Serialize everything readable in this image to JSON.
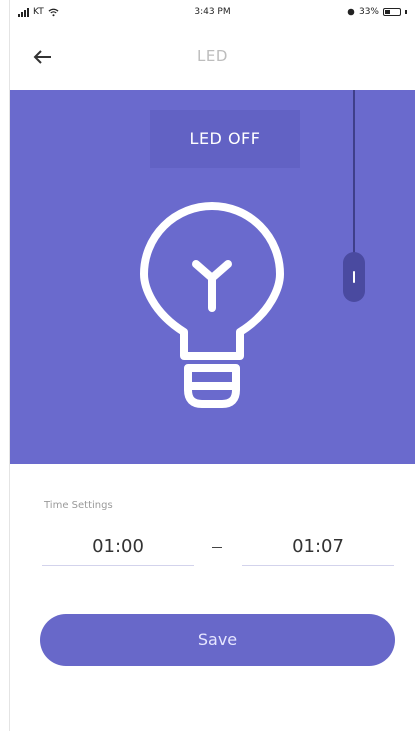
{
  "status_bar": {
    "carrier": "KT",
    "time": "3:43 PM",
    "battery_percent": "33%",
    "battery_level": 0.33,
    "signal_icon": "signal-bars-icon",
    "wifi_icon": "wifi-icon",
    "alarm_icon": "alarm-icon",
    "battery_icon": "battery-icon"
  },
  "nav": {
    "back_icon": "back-arrow-icon",
    "title": "LED"
  },
  "hero": {
    "caption": "LED OFF",
    "background_color": "#6a6acd",
    "bulb_icon": "light-bulb-icon",
    "pull_switch_icon": "pull-switch-icon"
  },
  "time_settings": {
    "label": "Time Settings",
    "start": "01:00",
    "end": "01:07"
  },
  "actions": {
    "save_label": "Save",
    "accent_color": "#6868c9"
  }
}
